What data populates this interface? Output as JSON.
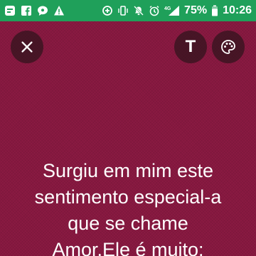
{
  "status_bar": {
    "background": "#1fa05a",
    "left_icons": [
      "notification-app-icon",
      "facebook-icon",
      "chat-bubble-icon",
      "warning-icon"
    ],
    "right_icons": [
      "data-saver-icon",
      "vibrate-icon",
      "mute-icon",
      "alarm-icon",
      "signal-4g-icon"
    ],
    "network_label": "4G",
    "battery_percent": "75%",
    "battery_level": 0.75,
    "time": "10:26"
  },
  "toolbar": {
    "close_icon": "close-icon",
    "text_label": "T",
    "palette_icon": "palette-icon"
  },
  "story": {
    "background": "#8a1a42",
    "lines": [
      "Surgiu em mim este",
      "sentimento especial-a",
      "que se chame",
      "Amor.Ele é muito:"
    ]
  }
}
